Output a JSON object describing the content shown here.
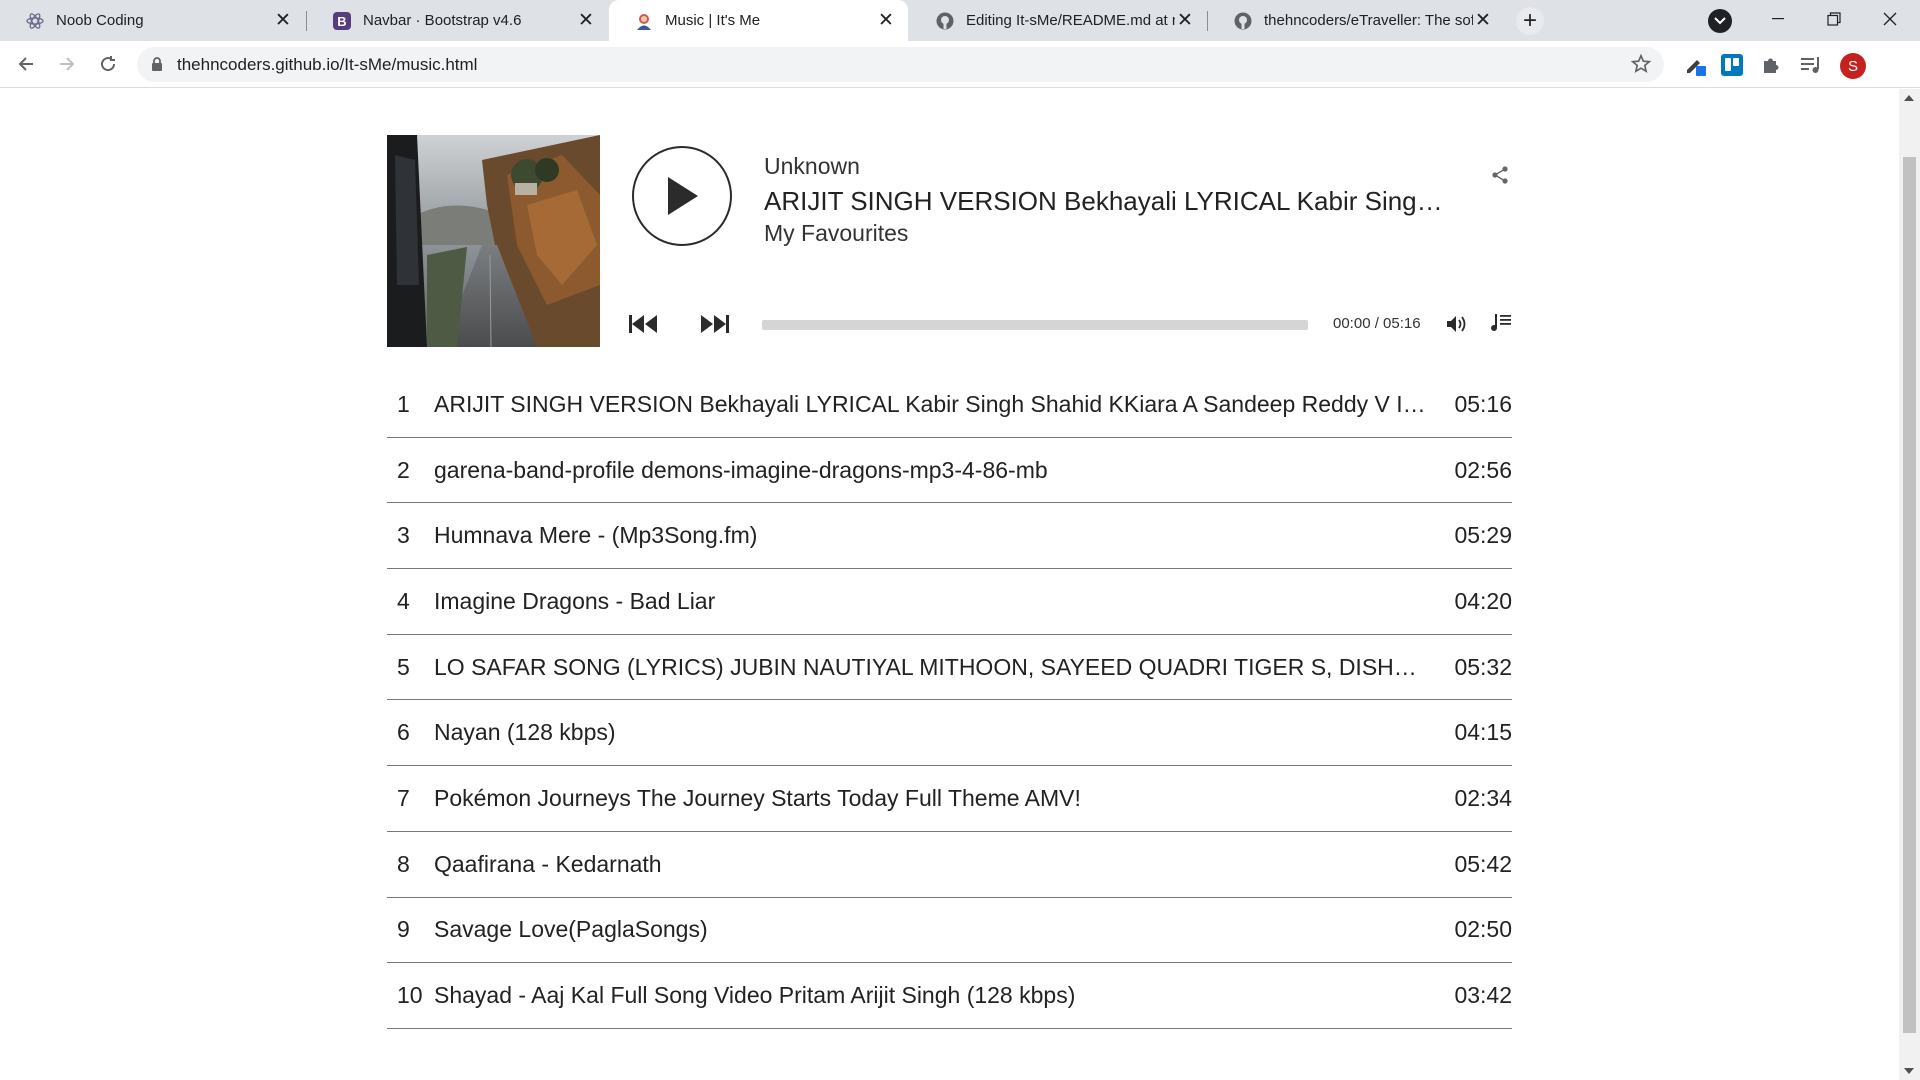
{
  "browser": {
    "tabs": [
      {
        "title": "Noob Coding",
        "icon": "noob-coding-favicon"
      },
      {
        "title": "Navbar · Bootstrap v4.6",
        "icon": "bootstrap-favicon"
      },
      {
        "title": "Music | It's Me",
        "icon": "its-me-favicon",
        "active": true
      },
      {
        "title": "Editing It-sMe/README.md at m",
        "icon": "github-favicon"
      },
      {
        "title": "thehncoders/eTraveller: The softw",
        "icon": "github-favicon"
      }
    ],
    "url": "thehncoders.github.io/It-sMe/music.html",
    "profile_initial": "S"
  },
  "player": {
    "artist": "Unknown",
    "title": "ARIJIT SINGH VERSION Bekhayali LYRICAL Kabir Singh Shahid KKiara A Sandeep Reddy V Irshad K",
    "album": "My Favourites",
    "time_display": "00:00 / 05:16",
    "progress": 0,
    "accent": "#2b2b2b"
  },
  "playlist": [
    {
      "num": "1",
      "title": "ARIJIT SINGH VERSION Bekhayali LYRICAL Kabir Singh Shahid KKiara A Sandeep Reddy V Irshad K",
      "duration": "05:16"
    },
    {
      "num": "2",
      "title": "garena-band-profile demons-imagine-dragons-mp3-4-86-mb",
      "duration": "02:56"
    },
    {
      "num": "3",
      "title": "Humnava Mere - (Mp3Song.fm)",
      "duration": "05:29"
    },
    {
      "num": "4",
      "title": "Imagine Dragons - Bad Liar",
      "duration": "04:20"
    },
    {
      "num": "5",
      "title": "LO SAFAR SONG (LYRICS) JUBIN NAUTIYAL MITHOON, SAYEED QUADRI TIGER S, DISHA PATANI",
      "duration": "05:32"
    },
    {
      "num": "6",
      "title": "Nayan (128 kbps)",
      "duration": "04:15"
    },
    {
      "num": "7",
      "title": "Pokémon Journeys The Journey Starts Today Full Theme AMV!",
      "duration": "02:34"
    },
    {
      "num": "8",
      "title": "Qaafirana - Kedarnath",
      "duration": "05:42"
    },
    {
      "num": "9",
      "title": "Savage Love(PaglaSongs)",
      "duration": "02:50"
    },
    {
      "num": "10",
      "title": "Shayad - Aaj Kal Full Song Video Pritam Arijit Singh (128 kbps)",
      "duration": "03:42"
    }
  ]
}
